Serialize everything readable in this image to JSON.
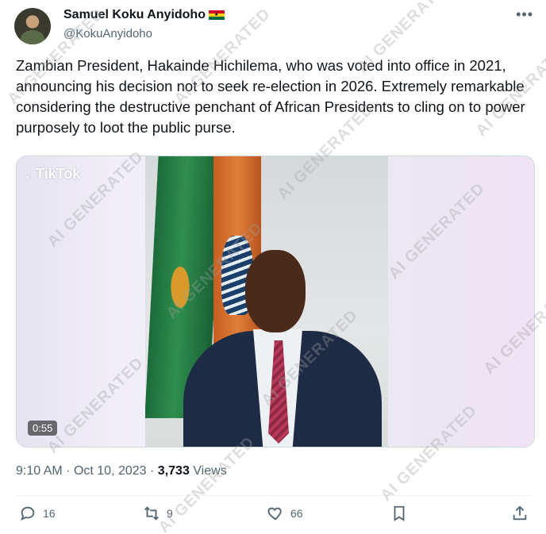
{
  "author": {
    "display_name": "Samuel Koku Anyidoho",
    "handle": "@KokuAnyidoho"
  },
  "more_icon": "more-horizontal-icon",
  "tweet_text": "Zambian President, Hakainde Hichilema,  who was voted into office in 2021, announcing his decision not to seek re-election in 2026. Extremely remarkable considering the destructive penchant of African Presidents to cling on to power purposely to loot the public purse.",
  "media": {
    "overlay_label": "TikTok",
    "duration": "0:55"
  },
  "meta": {
    "time": "9:10 AM",
    "date": "Oct 10, 2023",
    "views_count": "3,733",
    "views_label": "Views"
  },
  "actions": {
    "replies": "16",
    "retweets": "9",
    "likes": "66"
  },
  "watermark_text": "AI GENERATED",
  "colors": {
    "text_primary": "#0f1419",
    "text_secondary": "#536471",
    "flag_red": "#ce1126",
    "flag_gold": "#fcd116",
    "flag_green": "#006b3f"
  }
}
